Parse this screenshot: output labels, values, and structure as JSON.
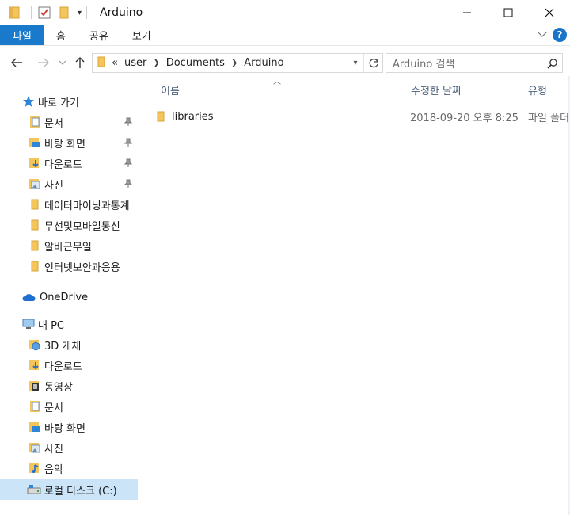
{
  "window": {
    "title": "Arduino",
    "controls": [
      "minimize",
      "maximize",
      "close"
    ]
  },
  "quick_access_toolbar": {
    "icons": [
      "folder-icon",
      "properties-checkbox-icon",
      "new-folder-icon"
    ],
    "dropdown_icon": "chevron-down-icon"
  },
  "ribbon": {
    "tabs": [
      {
        "label": "파일",
        "active": true
      },
      {
        "label": "홈"
      },
      {
        "label": "공유"
      },
      {
        "label": "보기"
      }
    ],
    "expand_icon": "chevron-down-icon",
    "help_label": "?"
  },
  "address": {
    "prefix": "«",
    "crumbs": [
      "user",
      "Documents",
      "Arduino"
    ],
    "search_placeholder": "Arduino 검색"
  },
  "nav": {
    "items": [
      {
        "label": "바로 가기",
        "icon": "star-icon",
        "level": 0
      },
      {
        "label": "문서",
        "icon": "documents-icon",
        "level": 1,
        "pinned": true
      },
      {
        "label": "바탕 화면",
        "icon": "desktop-icon",
        "level": 1,
        "pinned": true
      },
      {
        "label": "다운로드",
        "icon": "download-icon",
        "level": 1,
        "pinned": true
      },
      {
        "label": "사진",
        "icon": "pictures-icon",
        "level": 1,
        "pinned": true
      },
      {
        "label": "데이터마이닝과통계",
        "icon": "folder-icon",
        "level": 1
      },
      {
        "label": "무선및모바일통신",
        "icon": "folder-icon",
        "level": 1
      },
      {
        "label": "알바근무일",
        "icon": "folder-icon",
        "level": 1
      },
      {
        "label": "인터넷보안과응용",
        "icon": "folder-icon",
        "level": 1
      },
      {
        "label": "OneDrive",
        "icon": "cloud-icon",
        "level": 0
      },
      {
        "label": "내 PC",
        "icon": "computer-icon",
        "level": 0
      },
      {
        "label": "3D 개체",
        "icon": "3d-objects-icon",
        "level": 1
      },
      {
        "label": "다운로드",
        "icon": "download-icon",
        "level": 1
      },
      {
        "label": "동영상",
        "icon": "videos-icon",
        "level": 1
      },
      {
        "label": "문서",
        "icon": "documents-icon",
        "level": 1
      },
      {
        "label": "바탕 화면",
        "icon": "desktop-icon",
        "level": 1
      },
      {
        "label": "사진",
        "icon": "pictures-icon",
        "level": 1
      },
      {
        "label": "음악",
        "icon": "music-icon",
        "level": 1
      },
      {
        "label": "로컬 디스크 (C:)",
        "icon": "drive-icon",
        "level": 1,
        "selected": true
      }
    ]
  },
  "columns": {
    "name": "이름",
    "modified": "수정한 날짜",
    "type": "유형"
  },
  "files": [
    {
      "name": "libraries",
      "modified": "2018-09-20 오후 8:25",
      "type": "파일 폴더",
      "icon": "folder-icon"
    }
  ],
  "colors": {
    "accent": "#1979ca",
    "folder": "#f4c55b",
    "selected": "#cce4f7",
    "header_text": "#4c607a"
  }
}
